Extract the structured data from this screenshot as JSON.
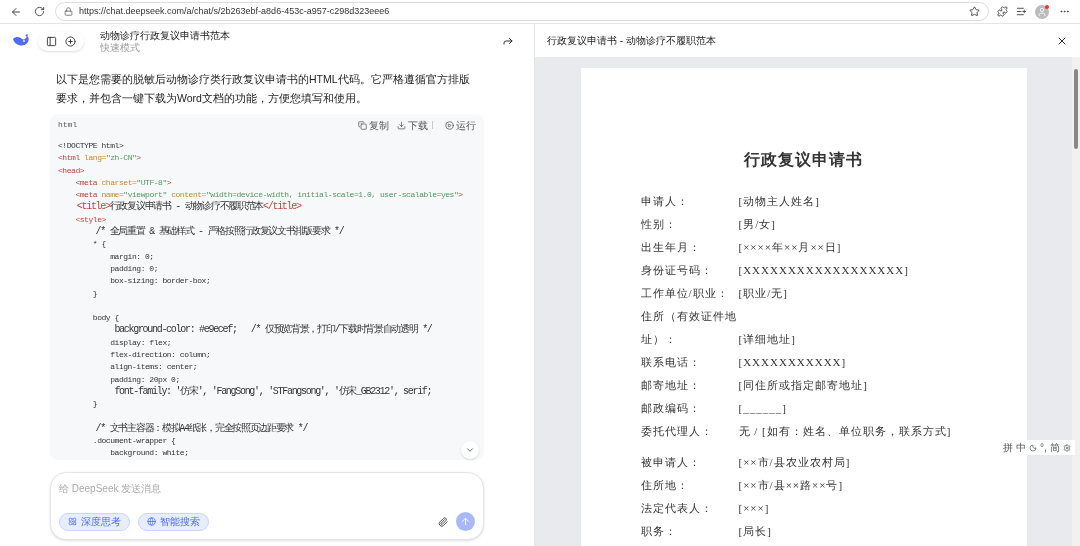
{
  "browser": {
    "url": "https://chat.deepseek.com/a/chat/s/2b263ebf-a8d6-453c-a957-c298d323eee6"
  },
  "chat": {
    "title": "动物诊疗行政复议申请书范本",
    "subtitle": "快速模式",
    "message": "以下是您需要的脱敏后动物诊疗类行政复议申请书的HTML代码。它严格遵循官方排版要求，并包含一键下载为Word文档的功能，方便您填写和使用。",
    "code": {
      "language": "html",
      "actions": [
        {
          "kind": "copy",
          "label": "复制"
        },
        {
          "kind": "download",
          "label": "下载"
        },
        {
          "kind": "run",
          "label": "运行"
        }
      ],
      "blocks": [
        [
          [
            {
              "kind": "plain",
              "text": "<!DOCTYPE html>"
            }
          ],
          [
            {
              "kind": "tag",
              "text": "<html"
            },
            {
              "kind": "attr",
              "text": " lang="
            },
            {
              "kind": "value",
              "text": "\"zh-CN\""
            },
            {
              "kind": "tag",
              "text": ">"
            }
          ],
          [
            {
              "kind": "tag",
              "text": "<head>"
            }
          ],
          [
            {
              "kind": "tag",
              "text": "    <meta"
            },
            {
              "kind": "attr",
              "text": " charset="
            },
            {
              "kind": "value",
              "text": "\"UTF-8\""
            },
            {
              "kind": "tag",
              "text": ">"
            }
          ],
          [
            {
              "kind": "tag",
              "text": "    <meta"
            },
            {
              "kind": "attr",
              "text": " name="
            },
            {
              "kind": "value",
              "text": "\"viewport\""
            },
            {
              "kind": "attr",
              "text": " content="
            },
            {
              "kind": "value",
              "text": "\"width=device-width, initial-scale=1.0, user-scalable=yes\""
            },
            {
              "kind": "tag",
              "text": ">"
            }
          ],
          [
            {
              "kind": "tag",
              "text": "    <title>"
            },
            {
              "kind": "plain",
              "text": "行政复议申请书 - 动物诊疗不履职范本"
            },
            {
              "kind": "tag",
              "text": "</title>"
            }
          ],
          [
            {
              "kind": "tag",
              "text": "    <style>"
            }
          ],
          [
            {
              "kind": "plain",
              "text": "        /* 全局重置 & 基础样式 - 严格按照行政复议文书排版要求 */"
            }
          ],
          [
            {
              "kind": "plain",
              "text": "        * {"
            }
          ],
          [
            {
              "kind": "plain",
              "text": "            margin: 0;"
            }
          ],
          [
            {
              "kind": "plain",
              "text": "            padding: 0;"
            }
          ],
          [
            {
              "kind": "plain",
              "text": "            box-sizing: border-box;"
            }
          ],
          [
            {
              "kind": "plain",
              "text": "        }"
            }
          ]
        ],
        [
          [
            {
              "kind": "plain",
              "text": "        body {"
            }
          ],
          [
            {
              "kind": "plain",
              "text": "            background-color: #e9ecef;   /* 仅预览背景，打印/下载时背景自动透明 */"
            }
          ],
          [
            {
              "kind": "plain",
              "text": "            display: flex;"
            }
          ],
          [
            {
              "kind": "plain",
              "text": "            flex-direction: column;"
            }
          ],
          [
            {
              "kind": "plain",
              "text": "            align-items: center;"
            }
          ],
          [
            {
              "kind": "plain",
              "text": "            padding: 20px 0;"
            }
          ],
          [
            {
              "kind": "plain",
              "text": "            font-family: '仿宋', 'FangSong', 'STFangsong', '仿宋_GB2312', serif;"
            }
          ],
          [
            {
              "kind": "plain",
              "text": "        }"
            }
          ]
        ],
        [
          [
            {
              "kind": "plain",
              "text": "        /* 文书主容器：模拟A4纸张，完全按照页边距要求 */"
            }
          ],
          [
            {
              "kind": "plain",
              "text": "        .document-wrapper {"
            }
          ],
          [
            {
              "kind": "plain",
              "text": "            background: white;"
            }
          ]
        ]
      ]
    },
    "input": {
      "placeholder": "给 DeepSeek 发送消息",
      "toggles": [
        {
          "kind": "think",
          "label": "深度思考",
          "selected": true
        },
        {
          "kind": "search",
          "label": "智能搜索",
          "selected": true
        }
      ]
    }
  },
  "preview": {
    "title": "行政复议申请书 - 动物诊疗不履职范本",
    "doc_title": "行政复议申请书",
    "sections": [
      [
        {
          "label": "申请人：",
          "value": "[动物主人姓名]"
        },
        {
          "label": "性别：",
          "value": "[男/女]"
        },
        {
          "label": "出生年月：",
          "value": "[××××年××月××日]"
        },
        {
          "label": "身份证号码：",
          "value": "[XXXXXXXXXXXXXXXXXX]"
        },
        {
          "label": "工作单位/职业：",
          "value": "[职业/无]"
        },
        {
          "label": "住所（有效证件地址）：",
          "value": "[详细地址]"
        },
        {
          "label": "联系电话：",
          "value": "[XXXXXXXXXXX]"
        },
        {
          "label": "邮寄地址：",
          "value": "[同住所或指定邮寄地址]"
        },
        {
          "label": "邮政编码：",
          "value": "[______]"
        },
        {
          "label": "委托代理人：",
          "value": "无 / [如有：姓名、单位职务，联系方式]"
        }
      ],
      [
        {
          "label": "被申请人：",
          "value": "[××市/县农业农村局]"
        },
        {
          "label": "住所地：",
          "value": "[××市/县××路××号]"
        },
        {
          "label": "法定代表人：",
          "value": "[×××]"
        },
        {
          "label": "职务：",
          "value": "[局长]"
        }
      ]
    ]
  },
  "ime_bar": [
    {
      "kind": "text",
      "text": "拼"
    },
    {
      "kind": "text",
      "text": "中"
    },
    {
      "kind": "moon"
    },
    {
      "kind": "text",
      "text": "°,"
    },
    {
      "kind": "text",
      "text": "简"
    },
    {
      "kind": "gear"
    }
  ]
}
